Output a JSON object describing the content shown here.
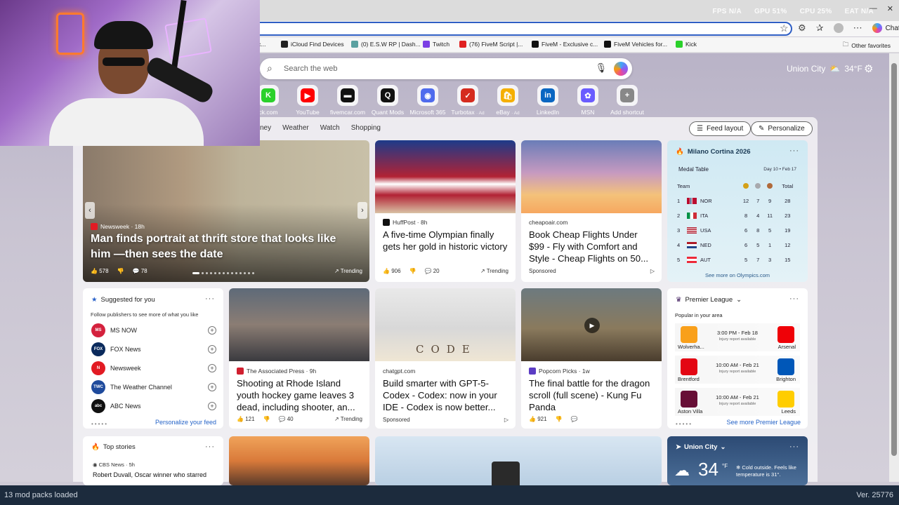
{
  "overlay": {
    "fps": "FPS",
    "fps_val": "N/A",
    "gpu": "GPU",
    "gpu_val": "51%",
    "cpu": "CPU",
    "cpu_val": "25%",
    "eat": "EAT",
    "eat_val": "N/A"
  },
  "toolbar": {
    "chat_label": "Chat"
  },
  "favorites": [
    {
      "label": "iCloud Find Devices",
      "color": "#222222"
    },
    {
      "label": "(0) E.S.W RP | Dash...",
      "color": "#5aa0a0"
    },
    {
      "label": "Twitch",
      "color": "#7b3fe4"
    },
    {
      "label": "(76) FiveM Script |...",
      "color": "#e02020"
    },
    {
      "label": "FiveM - Exclusive c...",
      "color": "#111111"
    },
    {
      "label": "FiveM Vehicles for...",
      "color": "#111111"
    },
    {
      "label": "Kick",
      "color": "#2bd12b"
    }
  ],
  "favorites_partial": "r c...",
  "other_favorites": "Other favorites",
  "search": {
    "placeholder": "Search the web"
  },
  "weather_top": {
    "city": "Union City",
    "temp": "34°F"
  },
  "shortcuts": [
    {
      "label": "ck.com",
      "ad": "",
      "color": "#2bd12b",
      "glyph": "K"
    },
    {
      "label": "YouTube",
      "ad": "",
      "color": "#ff0000",
      "glyph": "▶"
    },
    {
      "label": "fivemcar.com",
      "ad": "",
      "color": "#111111",
      "glyph": "▬"
    },
    {
      "label": "Quant Mods",
      "ad": "",
      "color": "#111111",
      "glyph": "Q"
    },
    {
      "label": "Microsoft 365",
      "ad": "",
      "color": "#4f6bed",
      "glyph": "◉"
    },
    {
      "label": "Turbotax",
      "ad": "· Ad",
      "color": "#d52b1e",
      "glyph": "✓"
    },
    {
      "label": "eBay",
      "ad": "· Ad",
      "color": "#f5af02",
      "glyph": "🛍"
    },
    {
      "label": "LinkedIn",
      "ad": "",
      "color": "#0a66c2",
      "glyph": "in"
    },
    {
      "label": "MSN",
      "ad": "",
      "color": "#6a5cff",
      "glyph": "✿"
    },
    {
      "label": "Add shortcut",
      "ad": "",
      "color": "#888888",
      "glyph": "+"
    }
  ],
  "feed_tabs": [
    "ney",
    "Weather",
    "Watch",
    "Shopping"
  ],
  "feed_layout": "Feed layout",
  "personalize": "Personalize",
  "hero": {
    "source": "Newsweek · 18h",
    "title": "Man finds portrait at thrift store that looks like him —then sees the date",
    "likes": "578",
    "comments": "78",
    "trending": "Trending"
  },
  "cards": [
    {
      "source": "HuffPost · 8h",
      "title": "A five-time Olympian finally gets her gold in historic victory",
      "likes": "906",
      "comments": "20",
      "trending": "Trending",
      "logo": "#111111"
    },
    {
      "source": "cheapoair.com",
      "title": "Book Cheap Flights Under $99 - Fly with Comfort and Style - Cheap Flights on 50...",
      "sponsored": "Sponsored",
      "logo": ""
    },
    {
      "source": "The Associated Press · 9h",
      "title": "Shooting at Rhode Island youth hockey game leaves 3 dead, including shooter, an...",
      "likes": "121",
      "comments": "40",
      "trending": "Trending",
      "logo": "#d01f2f"
    },
    {
      "source": "chatgpt.com",
      "title": "Build smarter with GPT-5-Codex - Codex: now in your IDE - Codex is now better...",
      "sponsored": "Sponsored",
      "logo": ""
    },
    {
      "source": "Popcorn Picks · 1w",
      "title": "The final battle for the dragon scroll (full scene) - Kung Fu Panda",
      "likes": "921",
      "logo": "#5b3cc4"
    }
  ],
  "medal": {
    "title": "Milano Cortina 2026",
    "subtitle": "Medal Table",
    "dates": "Day 10 • Feb 17",
    "team_col": "Team",
    "total_col": "Total",
    "rows": [
      {
        "rank": "1",
        "team": "NOR",
        "g": "12",
        "s": "7",
        "b": "9",
        "t": "28"
      },
      {
        "rank": "2",
        "team": "ITA",
        "g": "8",
        "s": "4",
        "b": "11",
        "t": "23"
      },
      {
        "rank": "3",
        "team": "USA",
        "g": "6",
        "s": "8",
        "b": "5",
        "t": "19"
      },
      {
        "rank": "4",
        "team": "NED",
        "g": "6",
        "s": "5",
        "b": "1",
        "t": "12"
      },
      {
        "rank": "5",
        "team": "AUT",
        "g": "5",
        "s": "7",
        "b": "3",
        "t": "15"
      }
    ],
    "more": "See more on Olympics.com"
  },
  "suggest": {
    "title": "Suggested for you",
    "desc": "Follow publishers to see more of what you like",
    "pubs": [
      {
        "name": "MS NOW",
        "color": "#d4213d",
        "abbr": "MS"
      },
      {
        "name": "FOX News",
        "color": "#0a2a5c",
        "abbr": "FOX"
      },
      {
        "name": "Newsweek",
        "color": "#e21b23",
        "abbr": "N"
      },
      {
        "name": "The Weather Channel",
        "color": "#1e4a9c",
        "abbr": "TWC"
      },
      {
        "name": "ABC News",
        "color": "#111111",
        "abbr": "abc"
      }
    ],
    "link": "Personalize your feed"
  },
  "premier": {
    "title": "Premier League",
    "subtitle": "Popular in your area",
    "matches": [
      {
        "home": "Wolverha...",
        "away": "Arsenal",
        "time": "3:00 PM - Feb 18",
        "note": "Injury report available",
        "hc": "#f9a01b",
        "ac": "#ef0107"
      },
      {
        "home": "Brentford",
        "away": "Brighton",
        "time": "10:00 AM - Feb 21",
        "note": "Injury report available",
        "hc": "#e30613",
        "ac": "#0057b8"
      },
      {
        "home": "Aston Villa",
        "away": "Leeds",
        "time": "10:00 AM - Feb 21",
        "note": "Injury report available",
        "hc": "#670e36",
        "ac": "#ffcd00"
      }
    ],
    "link": "See more Premier League"
  },
  "topstories": {
    "title": "Top stories",
    "source": "CBS News · 5h",
    "headline": "Robert Duvall, Oscar winner who starred"
  },
  "union": {
    "city": "Union City",
    "temp": "34",
    "unit": "°F",
    "note": "Cold outside. Feels like temperature is 31°."
  },
  "status": {
    "left": "13 mod packs loaded",
    "right": "Ver. 25776"
  }
}
